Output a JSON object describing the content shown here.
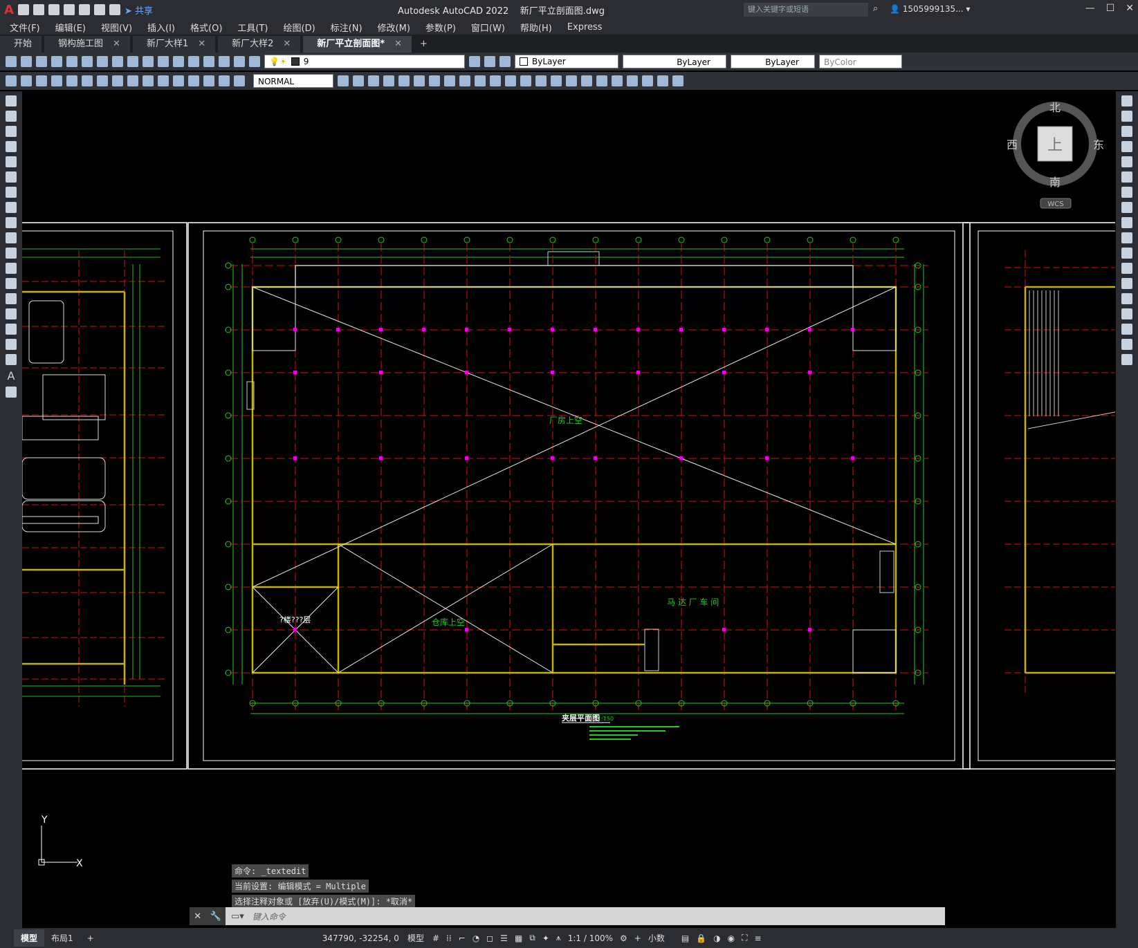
{
  "app": {
    "title": "Autodesk AutoCAD 2022",
    "file": "新厂平立剖面图.dwg",
    "share_label": "共享",
    "search_placeholder": "键入关键字或短语",
    "user": "1505999135...",
    "win": {
      "min": "—",
      "max": "☐",
      "close": "✕"
    }
  },
  "menu": [
    "文件(F)",
    "编辑(E)",
    "视图(V)",
    "插入(I)",
    "格式(O)",
    "工具(T)",
    "绘图(D)",
    "标注(N)",
    "修改(M)",
    "参数(P)",
    "窗口(W)",
    "帮助(H)",
    "Express"
  ],
  "tabs": [
    {
      "label": "开始",
      "closable": false
    },
    {
      "label": "钢构施工图",
      "closable": true
    },
    {
      "label": "新厂大样1",
      "closable": true
    },
    {
      "label": "新厂大样2",
      "closable": true
    },
    {
      "label": "新厂平立剖面图*",
      "closable": true,
      "active": true
    }
  ],
  "layer": {
    "value": "9"
  },
  "props": {
    "color": "ByLayer",
    "linetype": "ByLayer",
    "lineweight": "ByLayer",
    "plotstyle": "ByColor"
  },
  "dimstyle": "NORMAL",
  "viewcube": {
    "north": "北",
    "south": "南",
    "east": "东",
    "west": "西",
    "top": "上",
    "wcs": "WCS"
  },
  "drawing": {
    "label_factory_void": "厂房上空",
    "label_warehouse_void": "仓库上空",
    "label_motor_workshop": "马 达 厂 车 间",
    "label_unknown": "?楼???层",
    "plan_title": "夹层平面图",
    "plan_scale": "1:150"
  },
  "ucs": {
    "x": "X",
    "y": "Y"
  },
  "command": {
    "history": [
      "命令: _textedit",
      "当前设置: 编辑模式 = Multiple",
      "选择注释对象或 [放弃(U)/模式(M)]: *取消*"
    ],
    "placeholder": "键入命令"
  },
  "status": {
    "model_tab": "模型",
    "layout_tab": "布局1",
    "coords": "347790, -32254, 0",
    "model": "模型",
    "scale": "1:1 / 100%",
    "units": "小数"
  }
}
